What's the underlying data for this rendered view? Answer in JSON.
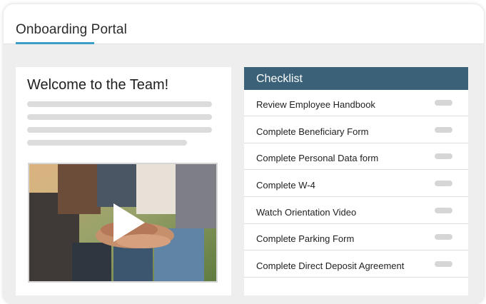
{
  "header": {
    "title": "Onboarding Portal"
  },
  "welcome": {
    "title": "Welcome to the Team!",
    "video": {
      "play_icon": "play-icon"
    }
  },
  "checklist": {
    "title": "Checklist",
    "items": [
      {
        "label": "Review Employee Handbook"
      },
      {
        "label": "Complete Beneficiary Form"
      },
      {
        "label": "Complete Personal Data form"
      },
      {
        "label": "Complete W-4"
      },
      {
        "label": "Watch Orientation Video"
      },
      {
        "label": "Complete Parking Form"
      },
      {
        "label": "Complete Direct Deposit Agreement"
      }
    ]
  },
  "colors": {
    "accent": "#3d9fc7",
    "checklist_header": "#3b6179"
  }
}
